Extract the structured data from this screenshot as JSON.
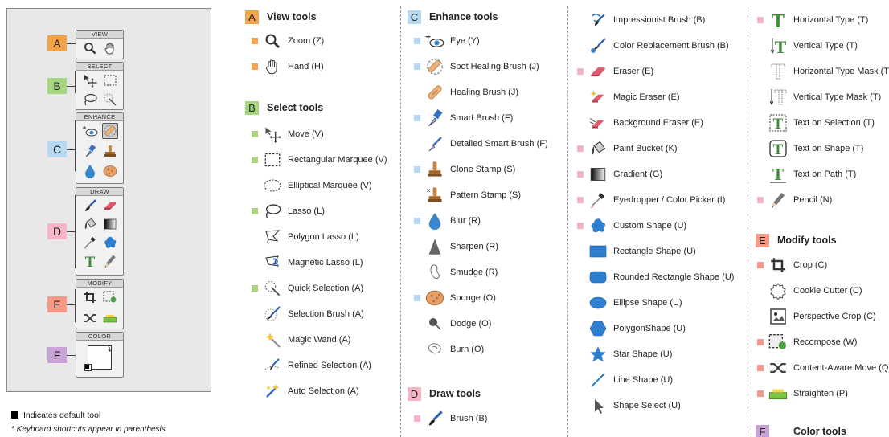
{
  "colors": {
    "view": "#f5a34a",
    "select": "#a6d77e",
    "enhance": "#b7d9f2",
    "draw": "#f6b6c6",
    "modify": "#f59a86",
    "color": "#c9a3d8"
  },
  "toolbox": {
    "panels": [
      "VIEW",
      "SELECT",
      "ENHANCE",
      "DRAW",
      "MODIFY",
      "COLOR"
    ],
    "letters": [
      "A",
      "B",
      "C",
      "D",
      "E",
      "F"
    ]
  },
  "notes": {
    "default_tool": "Indicates default tool",
    "shortcuts": "* Keyboard shortcuts appear in parenthesis"
  },
  "sections": {
    "view": {
      "letter": "A",
      "title": "View tools"
    },
    "select": {
      "letter": "B",
      "title": "Select tools"
    },
    "enhance": {
      "letter": "C",
      "title": "Enhance tools"
    },
    "draw": {
      "letter": "D",
      "title": "Draw tools"
    },
    "modify": {
      "letter": "E",
      "title": "Modify tools"
    },
    "color": {
      "letter": "F",
      "title": "Color tools"
    }
  },
  "tools": {
    "view": [
      {
        "label": "Zoom (Z)",
        "icon": "zoom-icon",
        "default": true
      },
      {
        "label": "Hand (H)",
        "icon": "hand-icon",
        "default": true
      }
    ],
    "select": [
      {
        "label": "Move (V)",
        "icon": "move-icon",
        "default": true
      },
      {
        "label": "Rectangular Marquee (V)",
        "icon": "rect-marquee-icon",
        "default": true
      },
      {
        "label": "Elliptical Marquee (V)",
        "icon": "ellip-marquee-icon",
        "default": false
      },
      {
        "label": "Lasso (L)",
        "icon": "lasso-icon",
        "default": true
      },
      {
        "label": "Polygon Lasso (L)",
        "icon": "polygon-lasso-icon",
        "default": false
      },
      {
        "label": "Magnetic Lasso (L)",
        "icon": "magnetic-lasso-icon",
        "default": false
      },
      {
        "label": "Quick Selection  (A)",
        "icon": "quick-selection-icon",
        "default": true
      },
      {
        "label": "Selection Brush (A)",
        "icon": "selection-brush-icon",
        "default": false
      },
      {
        "label": "Magic Wand (A)",
        "icon": "magic-wand-icon",
        "default": false
      },
      {
        "label": "Refined Selection (A)",
        "icon": "refined-selection-icon",
        "default": false
      },
      {
        "label": "Auto Selection (A)",
        "icon": "auto-selection-icon",
        "default": false
      }
    ],
    "enhance": [
      {
        "label": "Eye (Y)",
        "icon": "eye-icon",
        "default": true
      },
      {
        "label": "Spot Healing Brush (J)",
        "icon": "spot-healing-icon",
        "default": true
      },
      {
        "label": "Healing Brush (J)",
        "icon": "healing-brush-icon",
        "default": false
      },
      {
        "label": "Smart Brush (F)",
        "icon": "smart-brush-icon",
        "default": true
      },
      {
        "label": "Detailed Smart Brush (F)",
        "icon": "detailed-smart-brush-icon",
        "default": false
      },
      {
        "label": "Clone Stamp (S)",
        "icon": "clone-stamp-icon",
        "default": true
      },
      {
        "label": "Pattern Stamp (S)",
        "icon": "pattern-stamp-icon",
        "default": false
      },
      {
        "label": "Blur (R)",
        "icon": "blur-icon",
        "default": true
      },
      {
        "label": "Sharpen (R)",
        "icon": "sharpen-icon",
        "default": false
      },
      {
        "label": "Smudge (R)",
        "icon": "smudge-icon",
        "default": false
      },
      {
        "label": "Sponge (O)",
        "icon": "sponge-icon",
        "default": true
      },
      {
        "label": "Dodge (O)",
        "icon": "dodge-icon",
        "default": false
      },
      {
        "label": "Burn (O)",
        "icon": "burn-icon",
        "default": false
      }
    ],
    "draw_a": [
      {
        "label": "Brush (B)",
        "icon": "brush-icon",
        "default": true
      }
    ],
    "draw_b": [
      {
        "label": "Impressionist Brush (B)",
        "icon": "impressionist-brush-icon",
        "default": false
      },
      {
        "label": "Color Replacement Brush (B)",
        "icon": "color-replacement-icon",
        "default": false
      },
      {
        "label": "Eraser (E)",
        "icon": "eraser-icon",
        "default": true
      },
      {
        "label": "Magic Eraser (E)",
        "icon": "magic-eraser-icon",
        "default": false
      },
      {
        "label": "Background Eraser (E)",
        "icon": "background-eraser-icon",
        "default": false
      },
      {
        "label": "Paint Bucket (K)",
        "icon": "paint-bucket-icon",
        "default": true
      },
      {
        "label": "Gradient (G)",
        "icon": "gradient-icon",
        "default": true
      },
      {
        "label": "Eyedropper / Color Picker (I)",
        "icon": "eyedropper-icon",
        "default": true
      },
      {
        "label": "Custom Shape (U)",
        "icon": "custom-shape-icon",
        "default": true
      },
      {
        "label": "Rectangle Shape (U)",
        "icon": "rectangle-shape-icon",
        "default": false
      },
      {
        "label": "Rounded Rectangle Shape (U)",
        "icon": "rounded-rect-shape-icon",
        "default": false
      },
      {
        "label": "Ellipse Shape (U)",
        "icon": "ellipse-shape-icon",
        "default": false
      },
      {
        "label": "PolygonShape (U)",
        "icon": "polygon-shape-icon",
        "default": false
      },
      {
        "label": "Star Shape (U)",
        "icon": "star-shape-icon",
        "default": false
      },
      {
        "label": "Line Shape (U)",
        "icon": "line-shape-icon",
        "default": false
      },
      {
        "label": "Shape Select (U)",
        "icon": "shape-select-icon",
        "default": false
      }
    ],
    "draw_c": [
      {
        "label": "Horizontal Type (T)",
        "icon": "horizontal-type-icon",
        "default": true
      },
      {
        "label": "Vertical Type (T)",
        "icon": "vertical-type-icon",
        "default": false
      },
      {
        "label": "Horizontal Type Mask (T)",
        "icon": "horizontal-type-mask-icon",
        "default": false
      },
      {
        "label": "Vertical Type Mask (T)",
        "icon": "vertical-type-mask-icon",
        "default": false
      },
      {
        "label": "Text on Selection (T)",
        "icon": "text-on-selection-icon",
        "default": false
      },
      {
        "label": "Text on Shape (T)",
        "icon": "text-on-shape-icon",
        "default": false
      },
      {
        "label": "Text on Path (T)",
        "icon": "text-on-path-icon",
        "default": false
      },
      {
        "label": "Pencil (N)",
        "icon": "pencil-icon",
        "default": true
      }
    ],
    "modify": [
      {
        "label": "Crop (C)",
        "icon": "crop-icon",
        "default": true
      },
      {
        "label": "Cookie Cutter (C)",
        "icon": "cookie-cutter-icon",
        "default": false
      },
      {
        "label": "Perspective Crop (C)",
        "icon": "perspective-crop-icon",
        "default": false
      },
      {
        "label": "Recompose (W)",
        "icon": "recompose-icon",
        "default": true
      },
      {
        "label": "Content-Aware Move (Q)",
        "icon": "content-aware-move-icon",
        "default": true
      },
      {
        "label": "Straighten (P)",
        "icon": "straighten-icon",
        "default": true
      }
    ]
  }
}
